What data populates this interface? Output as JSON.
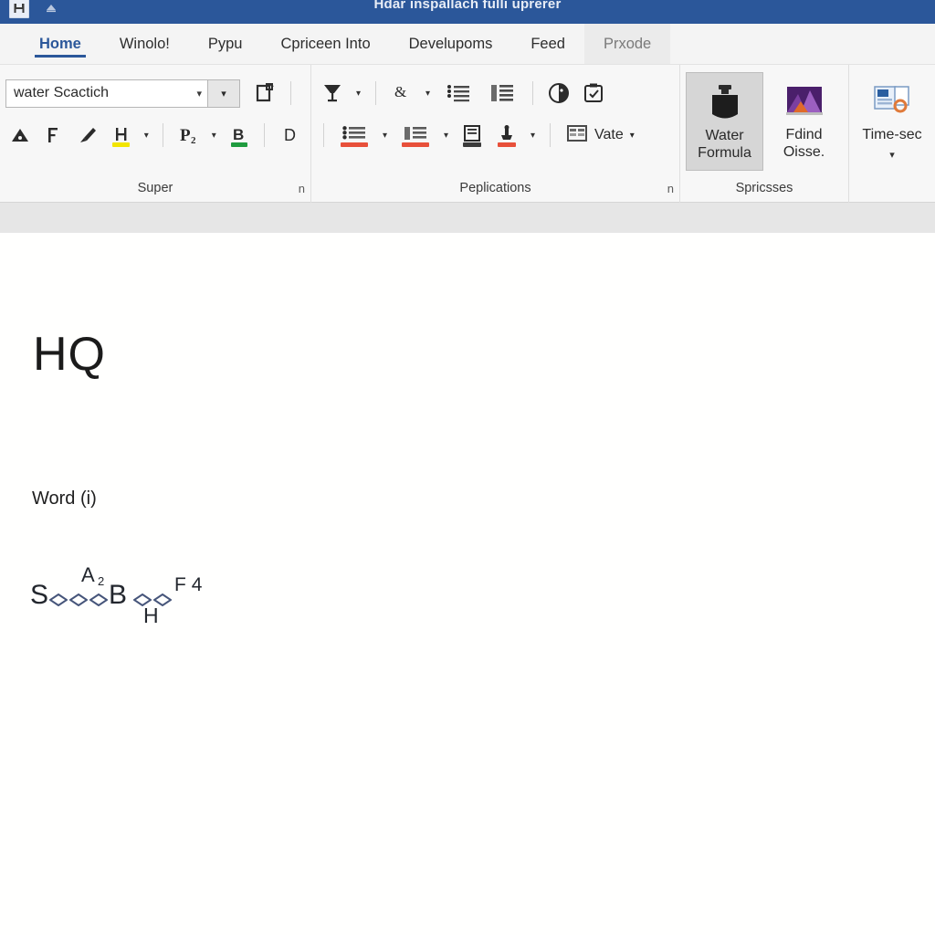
{
  "window": {
    "title": "Hdar inspallach fulli uprerer",
    "quick_access": [
      {
        "name": "save-icon",
        "label": "Save"
      },
      {
        "name": "undo-icon",
        "label": "Undo"
      }
    ]
  },
  "tabs": [
    {
      "label": "Home",
      "state": "active"
    },
    {
      "label": "Winolo!",
      "state": "normal"
    },
    {
      "label": "Pypu",
      "state": "normal"
    },
    {
      "label": "Cpriceen Into",
      "state": "normal"
    },
    {
      "label": "Develupoms",
      "state": "normal"
    },
    {
      "label": "Feed",
      "state": "normal"
    },
    {
      "label": "Prxode",
      "state": "contextual"
    }
  ],
  "ribbon": {
    "groups": [
      {
        "label": "Super",
        "dialog_launcher": "n",
        "font_combo": {
          "value": "water Scactich",
          "placeholder": "Font",
          "caret": "▾",
          "side_caret": "▾"
        },
        "row1_buttons": [
          {
            "name": "copy-format-icon",
            "label": "Format Painter"
          }
        ],
        "row2_buttons": [
          {
            "name": "increase-font-icon",
            "label": "A"
          },
          {
            "name": "text-effects-icon",
            "label": "F"
          },
          {
            "name": "clear-formatting-icon",
            "label": "Clear Formatting"
          },
          {
            "name": "text-highlight-icon",
            "label": "H",
            "cap_color": "#f2e500",
            "has_dropdown": true
          },
          {
            "name": "font-color-icon",
            "label": "P",
            "has_dropdown": true
          },
          {
            "name": "border-color-icon",
            "label": "B",
            "cap_color": "#1f9c3f"
          },
          {
            "name": "drop-cap-icon",
            "label": "D"
          }
        ]
      },
      {
        "label": "Peplications",
        "dialog_launcher": "n",
        "row1_buttons": [
          {
            "name": "filter-icon",
            "label": "Filter",
            "has_dropdown": true
          },
          {
            "name": "sort-icon",
            "label": "Sort",
            "has_dropdown": true
          },
          {
            "name": "numbered-list-icon",
            "label": "Numbering"
          },
          {
            "name": "multilevel-list-icon",
            "label": "Multilevel List"
          }
        ],
        "row2_buttons": [
          {
            "name": "bulleted-list-red-icon",
            "label": "Bullets",
            "cap_color": "#e8503a",
            "has_dropdown": true
          },
          {
            "name": "numbered-list-red-icon",
            "label": "Numbering",
            "cap_color": "#e8503a",
            "has_dropdown": true
          },
          {
            "name": "page-layout-icon",
            "label": "Layout",
            "cap_color": "#3a3a3a"
          },
          {
            "name": "insert-object-icon",
            "label": "Insert Object",
            "cap_color": "#e8503a",
            "has_dropdown": true
          }
        ],
        "row1_extra": [
          {
            "name": "globe-emoji-icon",
            "label": "Emoji"
          },
          {
            "name": "clipboard-check-icon",
            "label": "Clipboard"
          }
        ],
        "row2_extra": [
          {
            "name": "table-icon",
            "label": "Vate",
            "has_dropdown": true
          }
        ],
        "right_buttons": [
          {
            "name": "web-layout-icon",
            "label": "Web",
            "has_dropdown": true
          }
        ]
      },
      {
        "label": "Spricsses",
        "big_buttons": [
          {
            "name": "water-formula-button",
            "line1": "Water",
            "line2": "Formula",
            "selected": true,
            "icon": "inkwell-icon"
          },
          {
            "name": "find-oisse-button",
            "line1": "Fdind",
            "line2": "Oisse.",
            "selected": false,
            "icon": "chart-mountain-icon"
          }
        ]
      },
      {
        "label": "",
        "big_buttons": [
          {
            "name": "time-sec-button",
            "line1": "Time-sec",
            "line2": "",
            "selected": false,
            "icon": "slide-badge-icon",
            "caret": "▾"
          }
        ]
      }
    ]
  },
  "document": {
    "heading": "HQ",
    "paragraph": "Word (i)",
    "formula": {
      "lead": "S",
      "rings1": 3,
      "superscript": "A",
      "superscript_sub": "2",
      "mid": "B",
      "below": "H",
      "rings2": 2,
      "trail": "F 4"
    }
  },
  "colors": {
    "titlebar": "#2b579a",
    "accent": "#2b579a",
    "ribbon_bg": "#f7f7f7",
    "tab_bg": "#f4f4f4",
    "ruler_bg": "#e6e6e6",
    "page_bg": "#fffffe",
    "highlight_yellow": "#f2e500",
    "underline_green": "#1f9c3f",
    "list_red": "#e8503a",
    "formula_ink": "#23272e"
  }
}
